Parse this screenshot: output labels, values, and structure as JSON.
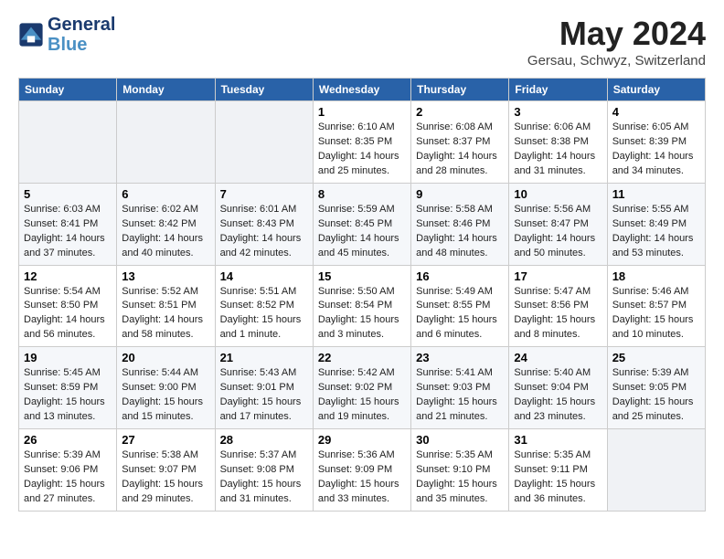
{
  "header": {
    "logo_line1": "General",
    "logo_line2": "Blue",
    "title": "May 2024",
    "location": "Gersau, Schwyz, Switzerland"
  },
  "weekdays": [
    "Sunday",
    "Monday",
    "Tuesday",
    "Wednesday",
    "Thursday",
    "Friday",
    "Saturday"
  ],
  "weeks": [
    [
      {
        "num": "",
        "info": ""
      },
      {
        "num": "",
        "info": ""
      },
      {
        "num": "",
        "info": ""
      },
      {
        "num": "1",
        "info": "Sunrise: 6:10 AM\nSunset: 8:35 PM\nDaylight: 14 hours\nand 25 minutes."
      },
      {
        "num": "2",
        "info": "Sunrise: 6:08 AM\nSunset: 8:37 PM\nDaylight: 14 hours\nand 28 minutes."
      },
      {
        "num": "3",
        "info": "Sunrise: 6:06 AM\nSunset: 8:38 PM\nDaylight: 14 hours\nand 31 minutes."
      },
      {
        "num": "4",
        "info": "Sunrise: 6:05 AM\nSunset: 8:39 PM\nDaylight: 14 hours\nand 34 minutes."
      }
    ],
    [
      {
        "num": "5",
        "info": "Sunrise: 6:03 AM\nSunset: 8:41 PM\nDaylight: 14 hours\nand 37 minutes."
      },
      {
        "num": "6",
        "info": "Sunrise: 6:02 AM\nSunset: 8:42 PM\nDaylight: 14 hours\nand 40 minutes."
      },
      {
        "num": "7",
        "info": "Sunrise: 6:01 AM\nSunset: 8:43 PM\nDaylight: 14 hours\nand 42 minutes."
      },
      {
        "num": "8",
        "info": "Sunrise: 5:59 AM\nSunset: 8:45 PM\nDaylight: 14 hours\nand 45 minutes."
      },
      {
        "num": "9",
        "info": "Sunrise: 5:58 AM\nSunset: 8:46 PM\nDaylight: 14 hours\nand 48 minutes."
      },
      {
        "num": "10",
        "info": "Sunrise: 5:56 AM\nSunset: 8:47 PM\nDaylight: 14 hours\nand 50 minutes."
      },
      {
        "num": "11",
        "info": "Sunrise: 5:55 AM\nSunset: 8:49 PM\nDaylight: 14 hours\nand 53 minutes."
      }
    ],
    [
      {
        "num": "12",
        "info": "Sunrise: 5:54 AM\nSunset: 8:50 PM\nDaylight: 14 hours\nand 56 minutes."
      },
      {
        "num": "13",
        "info": "Sunrise: 5:52 AM\nSunset: 8:51 PM\nDaylight: 14 hours\nand 58 minutes."
      },
      {
        "num": "14",
        "info": "Sunrise: 5:51 AM\nSunset: 8:52 PM\nDaylight: 15 hours\nand 1 minute."
      },
      {
        "num": "15",
        "info": "Sunrise: 5:50 AM\nSunset: 8:54 PM\nDaylight: 15 hours\nand 3 minutes."
      },
      {
        "num": "16",
        "info": "Sunrise: 5:49 AM\nSunset: 8:55 PM\nDaylight: 15 hours\nand 6 minutes."
      },
      {
        "num": "17",
        "info": "Sunrise: 5:47 AM\nSunset: 8:56 PM\nDaylight: 15 hours\nand 8 minutes."
      },
      {
        "num": "18",
        "info": "Sunrise: 5:46 AM\nSunset: 8:57 PM\nDaylight: 15 hours\nand 10 minutes."
      }
    ],
    [
      {
        "num": "19",
        "info": "Sunrise: 5:45 AM\nSunset: 8:59 PM\nDaylight: 15 hours\nand 13 minutes."
      },
      {
        "num": "20",
        "info": "Sunrise: 5:44 AM\nSunset: 9:00 PM\nDaylight: 15 hours\nand 15 minutes."
      },
      {
        "num": "21",
        "info": "Sunrise: 5:43 AM\nSunset: 9:01 PM\nDaylight: 15 hours\nand 17 minutes."
      },
      {
        "num": "22",
        "info": "Sunrise: 5:42 AM\nSunset: 9:02 PM\nDaylight: 15 hours\nand 19 minutes."
      },
      {
        "num": "23",
        "info": "Sunrise: 5:41 AM\nSunset: 9:03 PM\nDaylight: 15 hours\nand 21 minutes."
      },
      {
        "num": "24",
        "info": "Sunrise: 5:40 AM\nSunset: 9:04 PM\nDaylight: 15 hours\nand 23 minutes."
      },
      {
        "num": "25",
        "info": "Sunrise: 5:39 AM\nSunset: 9:05 PM\nDaylight: 15 hours\nand 25 minutes."
      }
    ],
    [
      {
        "num": "26",
        "info": "Sunrise: 5:39 AM\nSunset: 9:06 PM\nDaylight: 15 hours\nand 27 minutes."
      },
      {
        "num": "27",
        "info": "Sunrise: 5:38 AM\nSunset: 9:07 PM\nDaylight: 15 hours\nand 29 minutes."
      },
      {
        "num": "28",
        "info": "Sunrise: 5:37 AM\nSunset: 9:08 PM\nDaylight: 15 hours\nand 31 minutes."
      },
      {
        "num": "29",
        "info": "Sunrise: 5:36 AM\nSunset: 9:09 PM\nDaylight: 15 hours\nand 33 minutes."
      },
      {
        "num": "30",
        "info": "Sunrise: 5:35 AM\nSunset: 9:10 PM\nDaylight: 15 hours\nand 35 minutes."
      },
      {
        "num": "31",
        "info": "Sunrise: 5:35 AM\nSunset: 9:11 PM\nDaylight: 15 hours\nand 36 minutes."
      },
      {
        "num": "",
        "info": ""
      }
    ]
  ]
}
